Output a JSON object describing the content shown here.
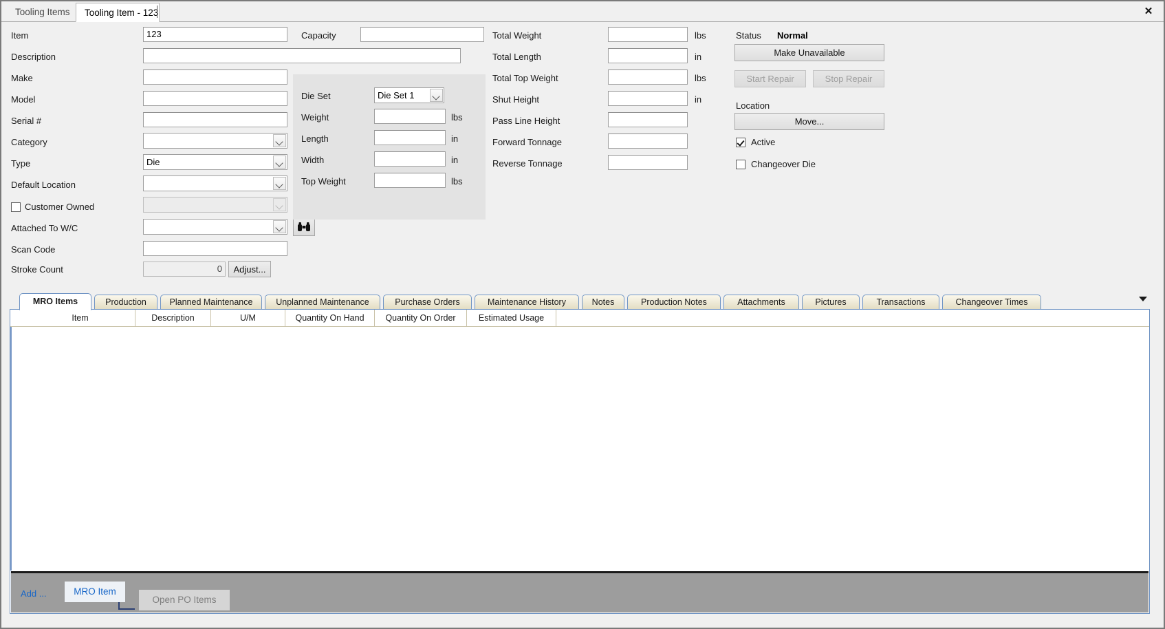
{
  "window": {
    "close_label": "✕",
    "tabs": [
      {
        "label": "Tooling Items",
        "active": false
      },
      {
        "label": "Tooling Item - 123",
        "active": true
      }
    ]
  },
  "form": {
    "left_fields": [
      {
        "label": "Item",
        "value": "123",
        "kind": "text"
      },
      {
        "label": "Description",
        "value": "",
        "kind": "text"
      },
      {
        "label": "Make",
        "value": "",
        "kind": "text"
      },
      {
        "label": "Model",
        "value": "",
        "kind": "text"
      },
      {
        "label": "Serial #",
        "value": "",
        "kind": "text"
      },
      {
        "label": "Category",
        "value": "",
        "kind": "combo"
      },
      {
        "label": "Type",
        "value": "Die",
        "kind": "combo"
      },
      {
        "label": "Default Location",
        "value": "",
        "kind": "combo"
      },
      {
        "label": "Customer Owned",
        "value": "",
        "kind": "combo-disabled"
      },
      {
        "label": "Attached To W/C",
        "value": "",
        "kind": "combo"
      },
      {
        "label": "Scan Code",
        "value": "",
        "kind": "text"
      },
      {
        "label": "Stroke Count",
        "value": "0",
        "kind": "readonly"
      }
    ],
    "capacity": {
      "label": "Capacity",
      "value": ""
    },
    "adjust_button": "Adjust...",
    "customer_owned_checkbox": {
      "label": "Customer Owned",
      "checked": false
    },
    "lookup_icon_1": "binoculars-icon",
    "lookup_icon_2": "binoculars-icon",
    "dieset_group": {
      "dieset": {
        "label": "Die Set",
        "value": "Die Set 1"
      },
      "rows": [
        {
          "label": "Weight",
          "value": "",
          "unit": "lbs"
        },
        {
          "label": "Length",
          "value": "",
          "unit": "in"
        },
        {
          "label": "Width",
          "value": "",
          "unit": "in"
        },
        {
          "label": "Top Weight",
          "value": "",
          "unit": "lbs"
        }
      ]
    },
    "totals": [
      {
        "label": "Total Weight",
        "value": "",
        "unit": "lbs"
      },
      {
        "label": "Total Length",
        "value": "",
        "unit": "in"
      },
      {
        "label": "Total Top Weight",
        "value": "",
        "unit": "lbs"
      },
      {
        "label": "Shut Height",
        "value": "",
        "unit": "in"
      },
      {
        "label": "Pass Line Height",
        "value": "",
        "unit": ""
      },
      {
        "label": "Forward Tonnage",
        "value": "",
        "unit": ""
      },
      {
        "label": "Reverse Tonnage",
        "value": "",
        "unit": ""
      }
    ],
    "status": {
      "label": "Status",
      "value": "Normal",
      "make_unavailable": "Make Unavailable",
      "start_repair": "Start Repair",
      "stop_repair": "Stop Repair",
      "location_label": "Location",
      "move_button": "Move...",
      "active_checkbox": {
        "label": "Active",
        "checked": true
      },
      "changeover_checkbox": {
        "label": "Changeover Die",
        "checked": false
      }
    }
  },
  "tabstrip": {
    "tabs": [
      {
        "label": "MRO Items",
        "active": true
      },
      {
        "label": "Production",
        "active": false
      },
      {
        "label": "Planned Maintenance",
        "active": false
      },
      {
        "label": "Unplanned Maintenance",
        "active": false
      },
      {
        "label": "Purchase Orders",
        "active": false
      },
      {
        "label": "Maintenance History",
        "active": false
      },
      {
        "label": "Notes",
        "active": false
      },
      {
        "label": "Production Notes",
        "active": false
      },
      {
        "label": "Attachments",
        "active": false
      },
      {
        "label": "Pictures",
        "active": false
      },
      {
        "label": "Transactions",
        "active": false
      },
      {
        "label": "Changeover Times",
        "active": false
      }
    ],
    "overflow_icon": "chevron-down-icon"
  },
  "grid": {
    "columns": [
      "Item",
      "Description",
      "U/M",
      "Quantity On Hand",
      "Quantity On Order",
      "Estimated Usage"
    ],
    "rows": []
  },
  "bottom_toolbar": {
    "add_label": "Add ...",
    "mro_item_button": "MRO Item",
    "open_po_items_button": "Open PO Items"
  },
  "colors": {
    "form_bg": "#f0f0f0",
    "group_bg": "#e3e3e3",
    "tab_border": "#6f94c4",
    "tab_gradient_top": "#fbf8ec",
    "tab_gradient_bottom": "#e2dcc2",
    "bottom_bar_bg": "#9d9d9d",
    "link_blue": "#1766c8"
  }
}
